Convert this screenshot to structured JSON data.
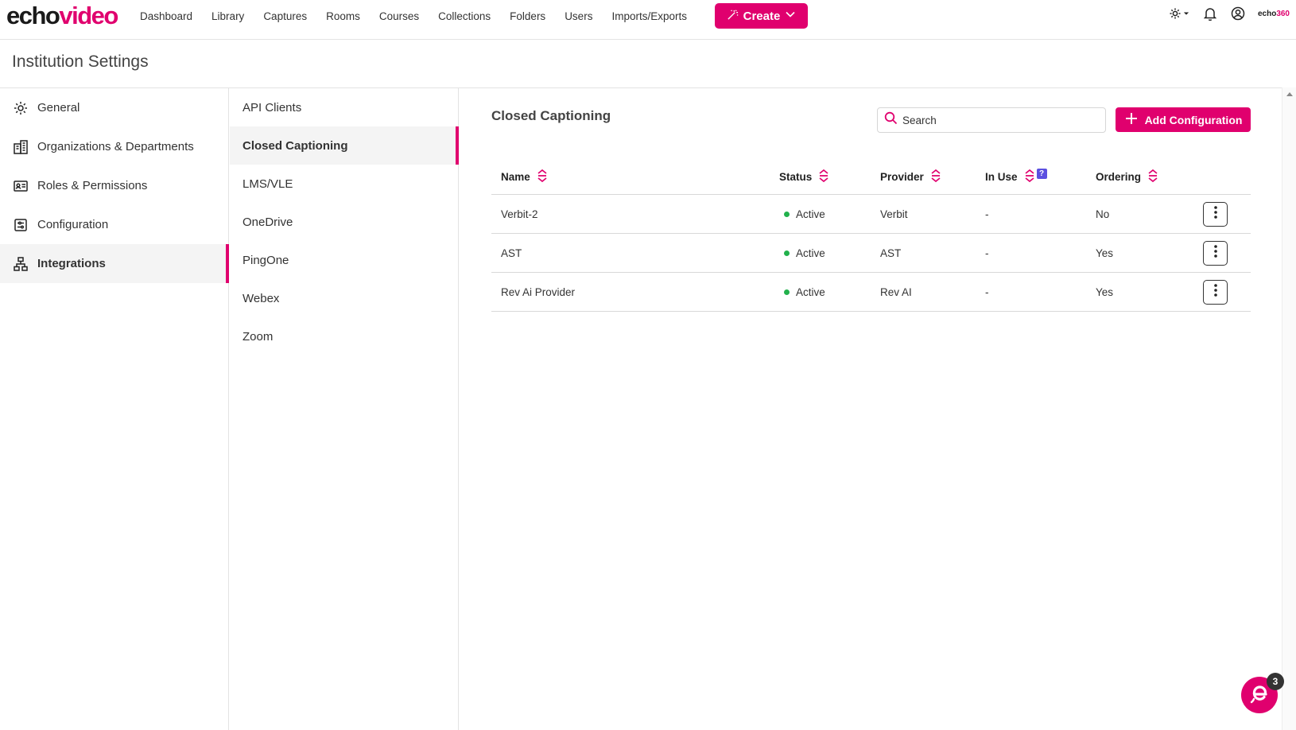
{
  "brand": {
    "logo_part1": "echo",
    "logo_part2": "video",
    "small_logo_part1": "echo",
    "small_logo_part2": "360"
  },
  "topnav": {
    "links": [
      "Dashboard",
      "Library",
      "Captures",
      "Rooms",
      "Courses",
      "Collections",
      "Folders",
      "Users",
      "Imports/Exports"
    ],
    "create_label": "Create",
    "icons": [
      "gear-icon",
      "bell-icon",
      "user-circle-icon"
    ]
  },
  "page": {
    "title": "Institution Settings"
  },
  "sidebar": {
    "items": [
      {
        "label": "General",
        "icon": "gear-icon",
        "active": false
      },
      {
        "label": "Organizations & Departments",
        "icon": "building-icon",
        "active": false
      },
      {
        "label": "Roles & Permissions",
        "icon": "id-card-icon",
        "active": false
      },
      {
        "label": "Configuration",
        "icon": "sliders-icon",
        "active": false
      },
      {
        "label": "Integrations",
        "icon": "network-icon",
        "active": true
      }
    ]
  },
  "subnav": {
    "items": [
      {
        "label": "API Clients",
        "active": false
      },
      {
        "label": "Closed Captioning",
        "active": true
      },
      {
        "label": "LMS/VLE",
        "active": false
      },
      {
        "label": "OneDrive",
        "active": false
      },
      {
        "label": "PingOne",
        "active": false
      },
      {
        "label": "Webex",
        "active": false
      },
      {
        "label": "Zoom",
        "active": false
      }
    ]
  },
  "main": {
    "title": "Closed Captioning",
    "search_placeholder": "Search",
    "add_button_label": "Add Configuration",
    "table": {
      "columns": [
        "Name",
        "Status",
        "Provider",
        "In Use",
        "Ordering"
      ],
      "in_use_help": "?",
      "rows": [
        {
          "name": "Verbit-2",
          "status": "Active",
          "provider": "Verbit",
          "in_use": "-",
          "ordering": "No"
        },
        {
          "name": "AST",
          "status": "Active",
          "provider": "AST",
          "in_use": "-",
          "ordering": "Yes"
        },
        {
          "name": "Rev Ai Provider",
          "status": "Active",
          "provider": "Rev AI",
          "in_use": "-",
          "ordering": "Yes"
        }
      ]
    }
  },
  "chat": {
    "badge_count": "3"
  },
  "colors": {
    "accent": "#e0006e",
    "status_active": "#22b14c",
    "help_badge": "#5b4fe0"
  }
}
